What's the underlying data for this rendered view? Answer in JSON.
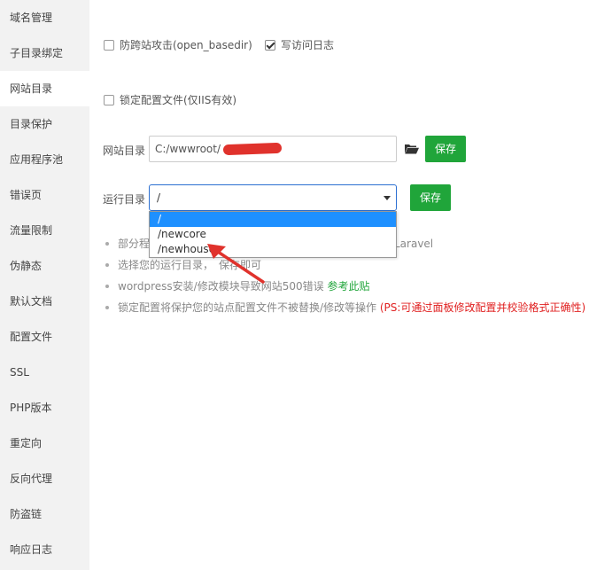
{
  "sidebar": {
    "items": [
      {
        "label": "域名管理"
      },
      {
        "label": "子目录绑定"
      },
      {
        "label": "网站目录"
      },
      {
        "label": "目录保护"
      },
      {
        "label": "应用程序池"
      },
      {
        "label": "错误页"
      },
      {
        "label": "流量限制"
      },
      {
        "label": "伪静态"
      },
      {
        "label": "默认文档"
      },
      {
        "label": "配置文件"
      },
      {
        "label": "SSL"
      },
      {
        "label": "PHP版本"
      },
      {
        "label": "重定向"
      },
      {
        "label": "反向代理"
      },
      {
        "label": "防盗链"
      },
      {
        "label": "响应日志"
      }
    ],
    "active_index": 2
  },
  "options": {
    "open_basedir": {
      "label": "防跨站攻击(open_basedir)",
      "checked": false
    },
    "access_log": {
      "label": "写访问日志",
      "checked": true
    },
    "lock_config": {
      "label": "锁定配置文件(仅IIS有效)",
      "checked": false
    }
  },
  "site_dir": {
    "label": "网站目录",
    "value": "C:/wwwroot/",
    "folder_icon": "folder-open-icon",
    "save_label": "保存"
  },
  "run_dir": {
    "label": "运行目录",
    "selected": "/",
    "options": [
      "/",
      "/newcore",
      "/newhouse"
    ],
    "save_label": "保存"
  },
  "tips": [
    {
      "text": "部分程",
      "tail": "Laravel"
    },
    {
      "text": "选择您的运行目录，",
      "tail": "保存即可"
    },
    {
      "text": "wordpress安装/修改模块导致网站500错误",
      "link": "参考此贴"
    },
    {
      "text": "锁定配置将保护您的站点配置文件不被替换/修改等操作",
      "warn": "(PS:可通过面板修改配置并校验格式正确性)"
    }
  ],
  "colors": {
    "accent_green": "#20a53a",
    "select_blue": "#1e90ff",
    "annotation_red": "#e0322c",
    "warn_red": "#e02020"
  }
}
